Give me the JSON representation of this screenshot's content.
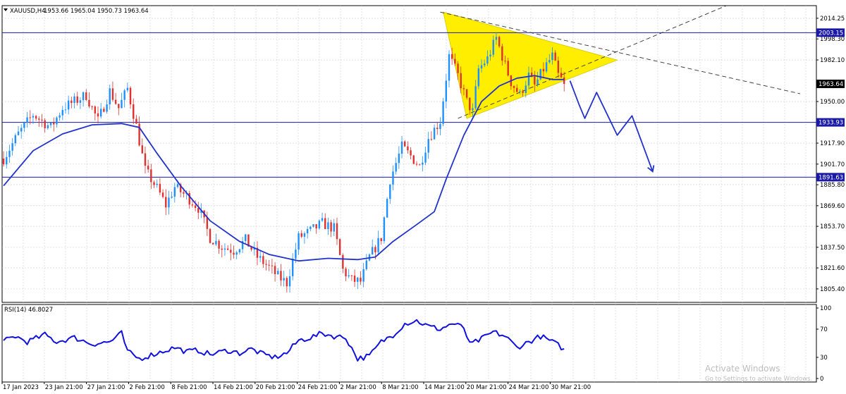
{
  "chart_data": [
    {
      "type": "candlestick",
      "symbol_label": "XAUUSD,H4",
      "ohlc_label": "1953.66 1965.04 1950.73 1963.64",
      "ylim": [
        1795,
        2024
      ],
      "y_ticks": [
        2014.25,
        1998.3,
        1982.1,
        1950.0,
        1917.9,
        1901.7,
        1885.8,
        1869.6,
        1853.7,
        1837.5,
        1821.6,
        1805.4
      ],
      "x_tick_labels": [
        "17 Jan 2023",
        "23 Jan 21:00",
        "27 Jan 21:00",
        "2 Feb 21:00",
        "8 Feb 21:00",
        "14 Feb 21:00",
        "20 Feb 21:00",
        "24 Feb 21:00",
        "2 Mar 21:00",
        "8 Mar 21:00",
        "14 Mar 21:00",
        "20 Mar 21:00",
        "24 Mar 21:00",
        "30 Mar 21:00"
      ],
      "current_price": 1963.64,
      "horizontal_levels": [
        2003.15,
        1933.93,
        1891.63
      ],
      "price_path": [
        [
          0,
          1906
        ],
        [
          5,
          1925
        ],
        [
          10,
          1940
        ],
        [
          16,
          1930
        ],
        [
          20,
          1945
        ],
        [
          24,
          1950
        ],
        [
          28,
          1955
        ],
        [
          32,
          1935
        ],
        [
          36,
          1958
        ],
        [
          39,
          1945
        ],
        [
          42,
          1960
        ],
        [
          45,
          1931
        ],
        [
          48,
          1897
        ],
        [
          52,
          1883
        ],
        [
          55,
          1870
        ],
        [
          58,
          1884
        ],
        [
          62,
          1877
        ],
        [
          66,
          1868
        ],
        [
          70,
          1845
        ],
        [
          74,
          1838
        ],
        [
          78,
          1835
        ],
        [
          82,
          1843
        ],
        [
          86,
          1830
        ],
        [
          90,
          1822
        ],
        [
          93,
          1815
        ],
        [
          96,
          1810
        ],
        [
          100,
          1845
        ],
        [
          104,
          1850
        ],
        [
          108,
          1856
        ],
        [
          112,
          1852
        ],
        [
          115,
          1820
        ],
        [
          118,
          1812
        ],
        [
          121,
          1811
        ],
        [
          124,
          1830
        ],
        [
          128,
          1845
        ],
        [
          131,
          1890
        ],
        [
          135,
          1915
        ],
        [
          138,
          1908
        ],
        [
          141,
          1900
        ],
        [
          144,
          1922
        ],
        [
          148,
          1935
        ],
        [
          151,
          1985
        ],
        [
          154,
          1970
        ],
        [
          157,
          1950
        ],
        [
          159,
          1942
        ],
        [
          161,
          1975
        ],
        [
          164,
          1983
        ],
        [
          167,
          1999
        ],
        [
          170,
          1978
        ],
        [
          172,
          1965
        ],
        [
          175,
          1955
        ],
        [
          178,
          1970
        ],
        [
          180,
          1962
        ],
        [
          183,
          1975
        ],
        [
          186,
          1985
        ],
        [
          188,
          1970
        ],
        [
          190,
          1963.64
        ]
      ],
      "moving_average": [
        [
          0,
          1885
        ],
        [
          10,
          1912
        ],
        [
          20,
          1925
        ],
        [
          30,
          1932
        ],
        [
          40,
          1933
        ],
        [
          46,
          1930
        ],
        [
          52,
          1910
        ],
        [
          60,
          1885
        ],
        [
          70,
          1858
        ],
        [
          80,
          1842
        ],
        [
          90,
          1832
        ],
        [
          100,
          1827
        ],
        [
          110,
          1829
        ],
        [
          120,
          1828
        ],
        [
          126,
          1830
        ],
        [
          132,
          1842
        ],
        [
          140,
          1855
        ],
        [
          146,
          1865
        ],
        [
          150,
          1890
        ],
        [
          156,
          1924
        ],
        [
          162,
          1950
        ],
        [
          168,
          1962
        ],
        [
          174,
          1968
        ],
        [
          180,
          1970
        ],
        [
          186,
          1967
        ],
        [
          190,
          1967
        ]
      ],
      "triangle_pattern": {
        "apex_high": [
          149,
          2019
        ],
        "apex_low": [
          157,
          1937
        ],
        "tip": [
          208,
          1982
        ]
      },
      "trendlines": [
        {
          "from": [
            148,
            2019
          ],
          "to": [
            270,
            1956
          ]
        },
        {
          "from": [
            154,
            1937
          ],
          "to": [
            245,
            2024
          ]
        }
      ],
      "projection_path": [
        [
          192,
          1966
        ],
        [
          195,
          1948
        ],
        [
          197,
          1937
        ],
        [
          201,
          1957
        ],
        [
          208,
          1924
        ],
        [
          213,
          1939
        ],
        [
          220,
          1896
        ]
      ]
    },
    {
      "type": "line",
      "label": "RSI(14) 46.8027",
      "ylim": [
        0,
        100
      ],
      "y_ticks": [
        100,
        70,
        30,
        0
      ],
      "values": [
        [
          0,
          54
        ],
        [
          4,
          60
        ],
        [
          8,
          52
        ],
        [
          14,
          62
        ],
        [
          18,
          52
        ],
        [
          24,
          58
        ],
        [
          30,
          49
        ],
        [
          36,
          52
        ],
        [
          40,
          64
        ],
        [
          42,
          38
        ],
        [
          46,
          28
        ],
        [
          52,
          36
        ],
        [
          58,
          44
        ],
        [
          62,
          38
        ],
        [
          66,
          40
        ],
        [
          70,
          34
        ],
        [
          76,
          40
        ],
        [
          80,
          36
        ],
        [
          84,
          42
        ],
        [
          88,
          34
        ],
        [
          92,
          30
        ],
        [
          96,
          36
        ],
        [
          100,
          54
        ],
        [
          104,
          58
        ],
        [
          108,
          64
        ],
        [
          112,
          60
        ],
        [
          116,
          58
        ],
        [
          120,
          28
        ],
        [
          124,
          32
        ],
        [
          128,
          52
        ],
        [
          132,
          62
        ],
        [
          136,
          78
        ],
        [
          140,
          82
        ],
        [
          144,
          74
        ],
        [
          148,
          70
        ],
        [
          152,
          78
        ],
        [
          156,
          72
        ],
        [
          158,
          48
        ],
        [
          162,
          56
        ],
        [
          166,
          66
        ],
        [
          170,
          60
        ],
        [
          174,
          44
        ],
        [
          178,
          52
        ],
        [
          182,
          60
        ],
        [
          186,
          52
        ],
        [
          190,
          42
        ]
      ]
    }
  ],
  "watermark": {
    "title": "Activate Windows",
    "subtitle": "Go to Settings to activate Windows."
  },
  "colors": {
    "bull_candle": "#1e90ff",
    "bear_candle": "#e03030",
    "moving_average": "#2233cc",
    "levels": "#1a1aa6",
    "triangle": "#ffee00",
    "rsi": "#1111dd"
  }
}
